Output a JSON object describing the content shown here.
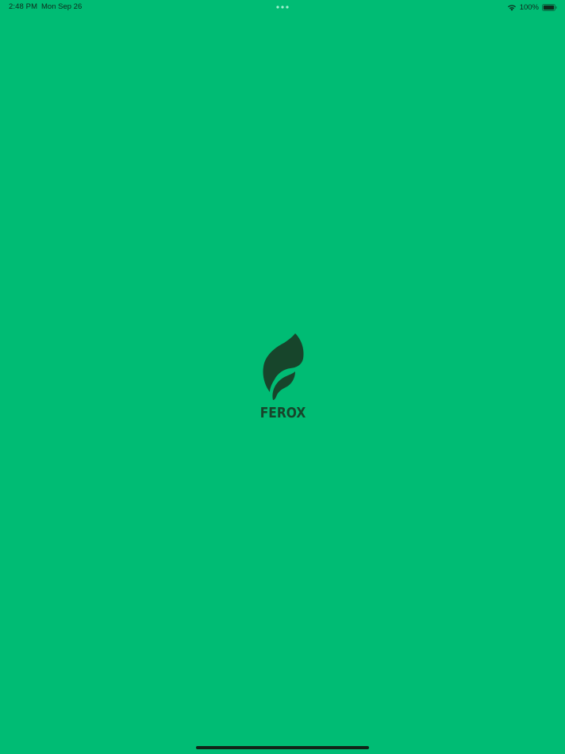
{
  "status_bar": {
    "time": "2:48 PM",
    "date": "Mon Sep 26",
    "battery": "100%",
    "icons": [
      "wifi-icon",
      "battery-icon",
      "multitask-dots-icon"
    ]
  },
  "splash": {
    "brand_name": "FEROX",
    "logo_icon": "leaf-icon"
  },
  "colors": {
    "background": "#00bc74",
    "logo": "#17452b",
    "status_text": "#0f2a1c"
  }
}
